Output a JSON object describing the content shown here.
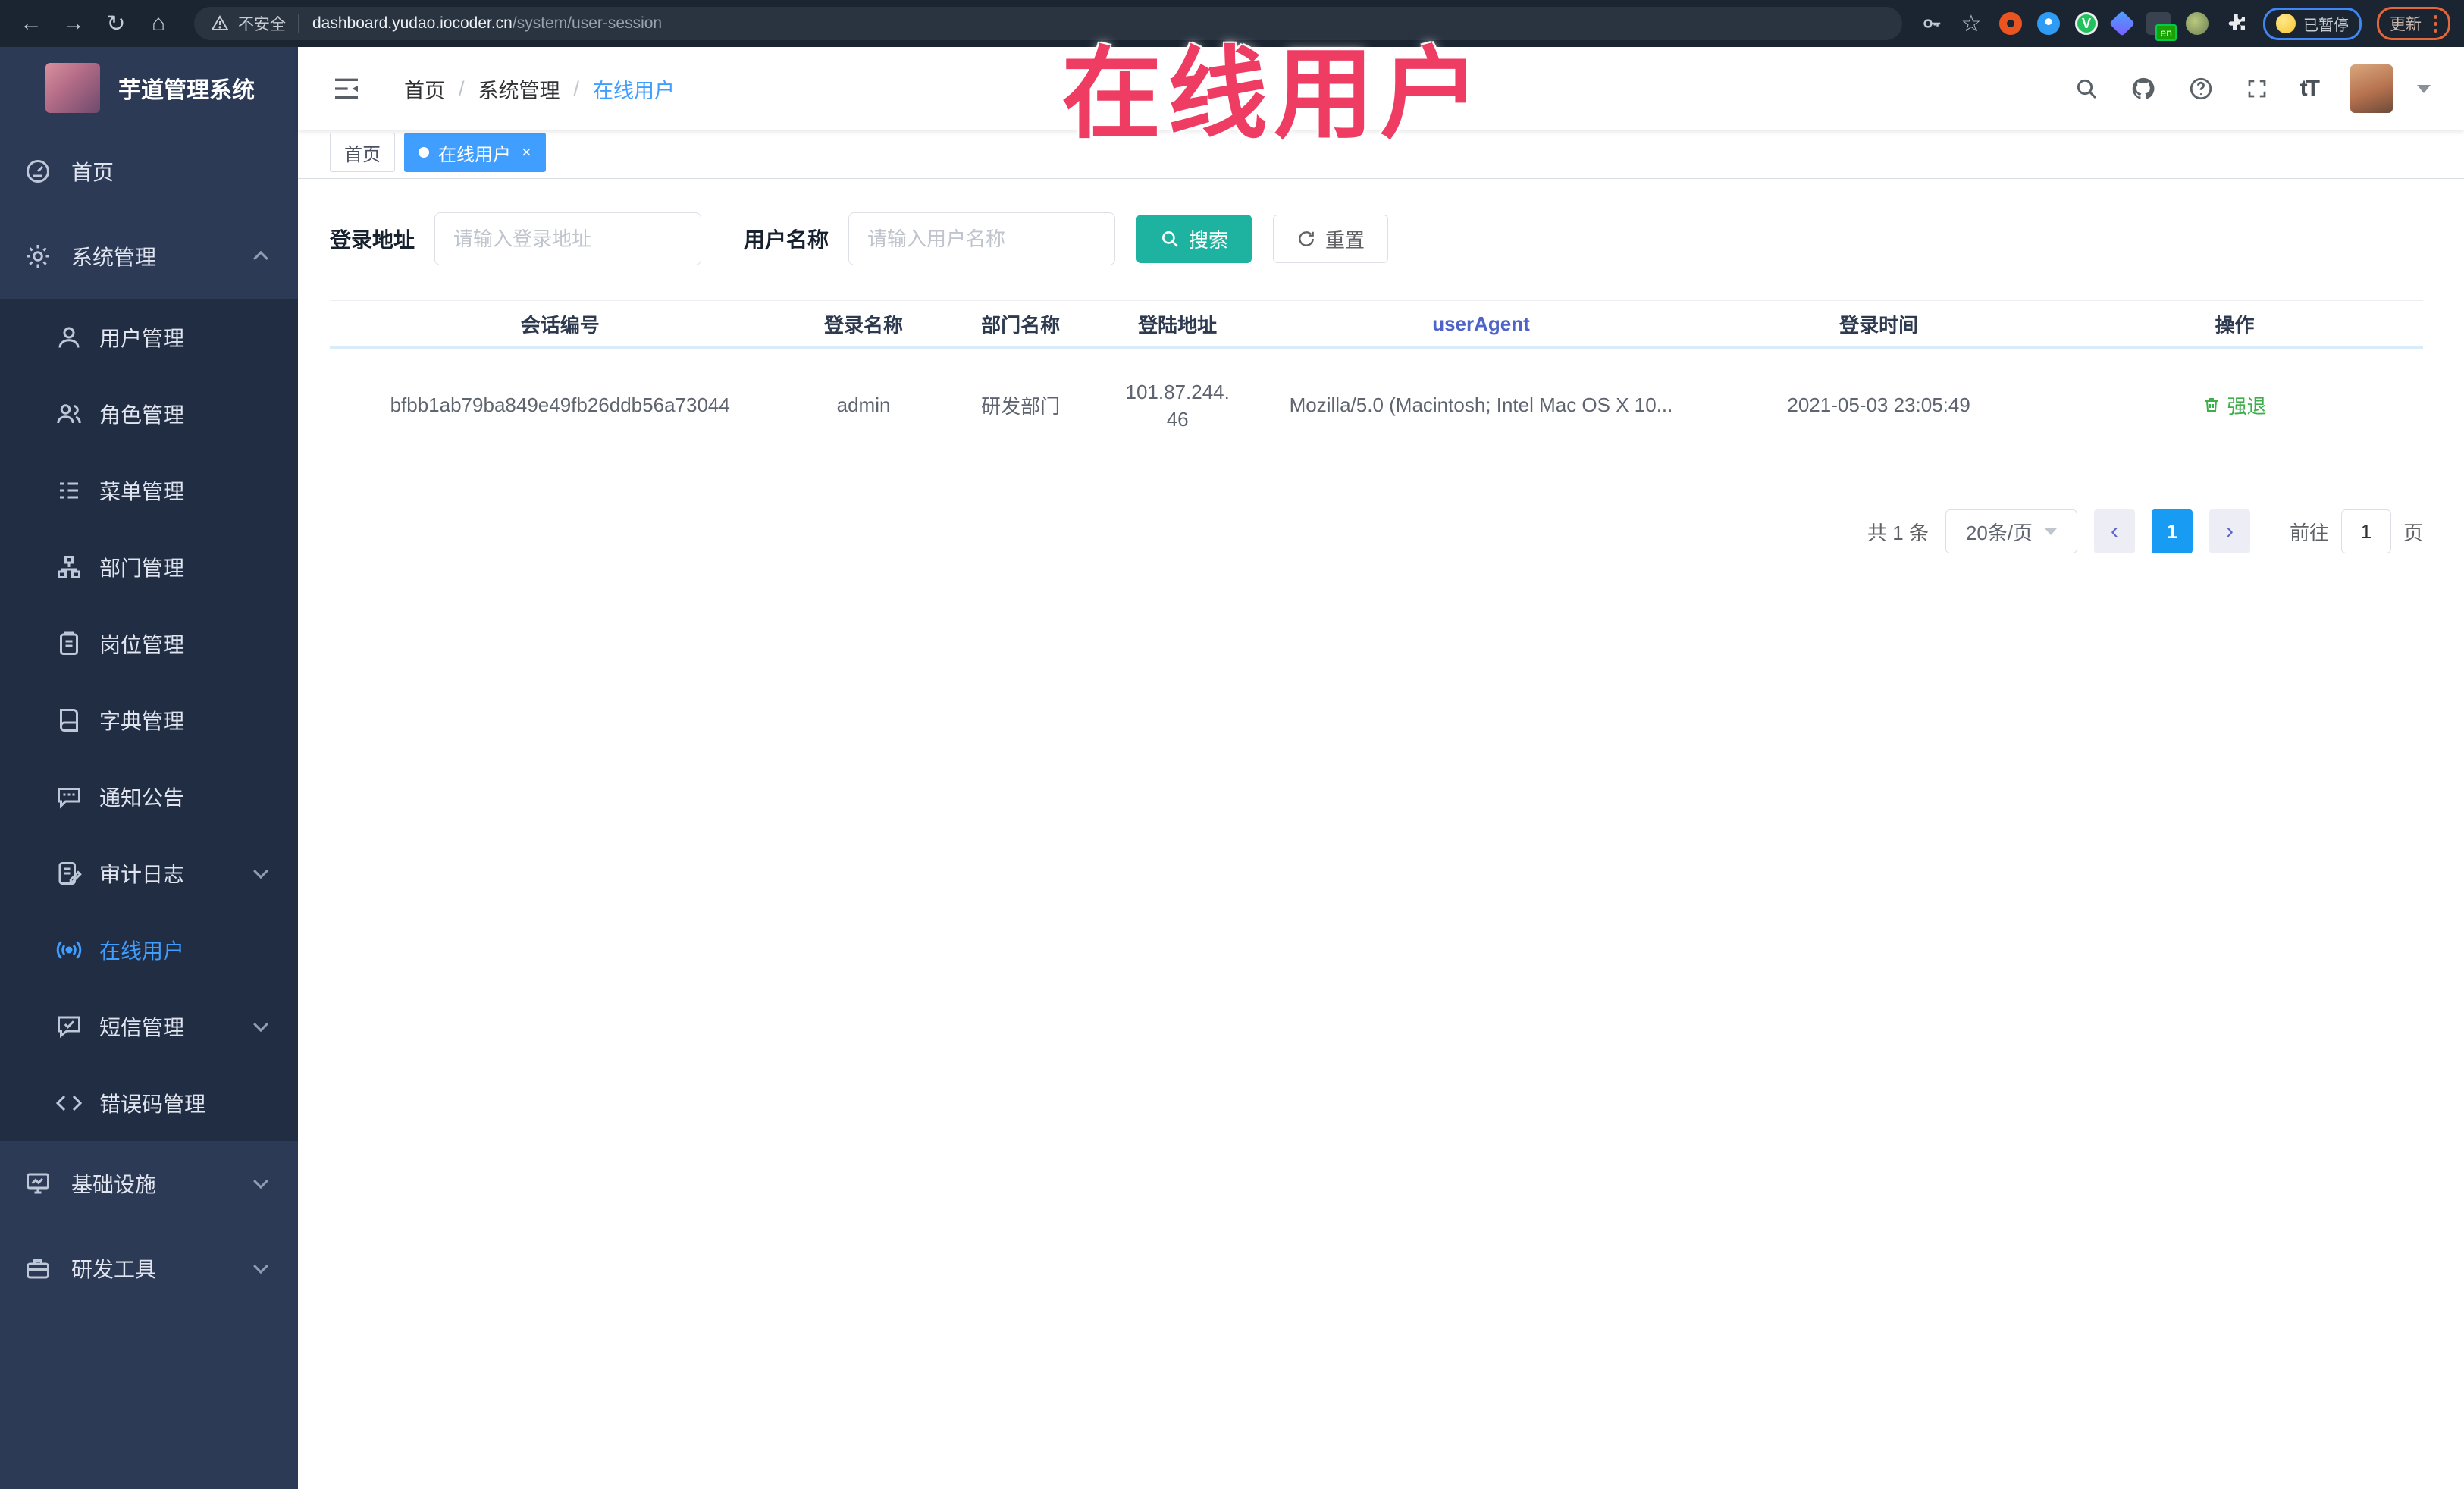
{
  "browser": {
    "icons": {
      "back": "←",
      "forward": "→",
      "reload": "↻",
      "home": "⌂",
      "star": "☆",
      "v_badge": "V"
    },
    "security_label": "不安全",
    "url_host": "dashboard.yudao.iocoder.cn",
    "url_path": "/system/user-session",
    "translate_badge": "en",
    "paused_label": "已暂停",
    "update_label": "更新"
  },
  "overlay": {
    "text": "在线用户",
    "color": "#ee3c63"
  },
  "sidebar": {
    "app_title": "芋道管理系统",
    "items": [
      {
        "label": "首页",
        "icon": "dashboard-icon",
        "level": "top"
      },
      {
        "label": "系统管理",
        "icon": "gear-icon",
        "level": "top",
        "chevron": "up"
      },
      {
        "label": "用户管理",
        "icon": "user-icon",
        "level": "sub"
      },
      {
        "label": "角色管理",
        "icon": "role-icon",
        "level": "sub"
      },
      {
        "label": "菜单管理",
        "icon": "menu-list-icon",
        "level": "sub"
      },
      {
        "label": "部门管理",
        "icon": "org-tree-icon",
        "level": "sub"
      },
      {
        "label": "岗位管理",
        "icon": "badge-icon",
        "level": "sub"
      },
      {
        "label": "字典管理",
        "icon": "dict-icon",
        "level": "sub"
      },
      {
        "label": "通知公告",
        "icon": "notice-icon",
        "level": "sub"
      },
      {
        "label": "审计日志",
        "icon": "audit-icon",
        "level": "sub",
        "chevron": "down"
      },
      {
        "label": "在线用户",
        "icon": "online-icon",
        "level": "sub",
        "active": true
      },
      {
        "label": "短信管理",
        "icon": "sms-icon",
        "level": "sub",
        "chevron": "down"
      },
      {
        "label": "错误码管理",
        "icon": "code-icon",
        "level": "sub"
      },
      {
        "label": "基础设施",
        "icon": "infra-icon",
        "level": "top",
        "chevron": "down"
      },
      {
        "label": "研发工具",
        "icon": "tools-icon",
        "level": "top",
        "chevron": "down"
      }
    ]
  },
  "header": {
    "breadcrumb": [
      "首页",
      "系统管理",
      "在线用户"
    ],
    "separator": "/",
    "font_icon": "tT"
  },
  "tabbar": {
    "tabs": [
      {
        "label": "首页"
      },
      {
        "label": "在线用户"
      }
    ],
    "close_icon": "×"
  },
  "filters": {
    "login_address_label": "登录地址",
    "login_address_placeholder": "请输入登录地址",
    "username_label": "用户名称",
    "username_placeholder": "请输入用户名称",
    "search_label": "搜索",
    "reset_label": "重置"
  },
  "table": {
    "columns": [
      "会话编号",
      "登录名称",
      "部门名称",
      "登陆地址",
      "userAgent",
      "登录时间",
      "操作"
    ],
    "rows": [
      {
        "session_id": "bfbb1ab79ba849e49fb26ddb56a73044",
        "login_name": "admin",
        "dept_name": "研发部门",
        "ip_line1": "101.87.244.",
        "ip_line2": "46",
        "user_agent": "Mozilla/5.0 (Macintosh; Intel Mac OS X 10...",
        "login_time": "2021-05-03 23:05:49",
        "action_label": "强退"
      }
    ]
  },
  "pagination": {
    "total": "共 1 条",
    "page_size": "20条/页",
    "prev_icon": "‹",
    "next_icon": "›",
    "current_page": "1",
    "goto_label": "前往",
    "goto_value": "1",
    "page_unit": "页"
  }
}
